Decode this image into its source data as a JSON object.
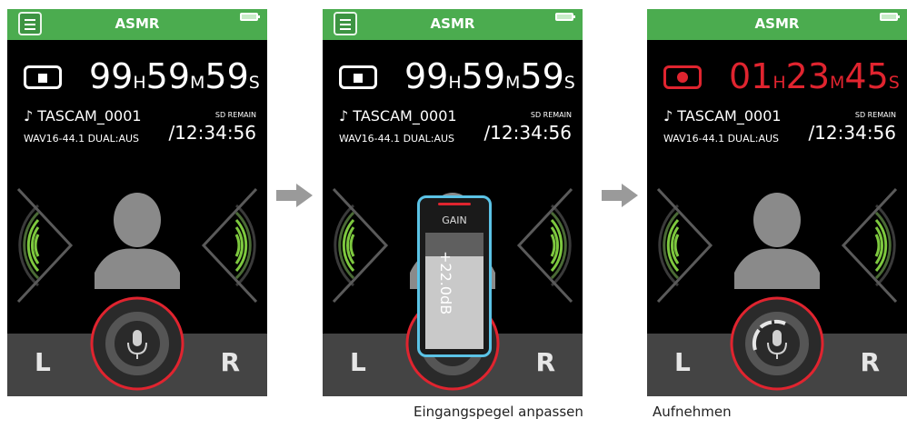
{
  "colors": {
    "accent_green": "#4bac4f",
    "rec_red": "#e0242f",
    "gain_blue": "#5bc3e6",
    "wave_green": "#7dc83e"
  },
  "screens": [
    {
      "title": "ASMR",
      "transport_icon": "stop-icon",
      "time": {
        "h": "99",
        "h_unit": "H",
        "m": "59",
        "m_unit": "M",
        "s": "59",
        "s_unit": "S"
      },
      "filename": "♪ TASCAM_0001",
      "format": "WAV16-44.1 DUAL:AUS",
      "sd_label": "SD REMAIN",
      "sd_remain": "/12:34:56",
      "channel_left": "L",
      "channel_right": "R"
    },
    {
      "title": "ASMR",
      "transport_icon": "stop-icon",
      "time": {
        "h": "99",
        "h_unit": "H",
        "m": "59",
        "m_unit": "M",
        "s": "59",
        "s_unit": "S"
      },
      "filename": "♪ TASCAM_0001",
      "format": "WAV16-44.1 DUAL:AUS",
      "sd_label": "SD REMAIN",
      "sd_remain": "/12:34:56",
      "channel_left": "L",
      "channel_right": "R",
      "gain": {
        "label": "GAIN",
        "value": "+22.0dB",
        "level": 0.8
      }
    },
    {
      "title": "ASMR",
      "transport_icon": "record-icon",
      "time": {
        "h": "01",
        "h_unit": "H",
        "m": "23",
        "m_unit": "M",
        "s": "45",
        "s_unit": "S"
      },
      "filename": "♪ TASCAM_0001",
      "format": "WAV16-44.1 DUAL:AUS",
      "sd_label": "SD REMAIN",
      "sd_remain": "/12:34:56",
      "channel_left": "L",
      "channel_right": "R"
    }
  ],
  "captions": [
    "Eingangspegel anpassen",
    "Aufnehmen"
  ]
}
